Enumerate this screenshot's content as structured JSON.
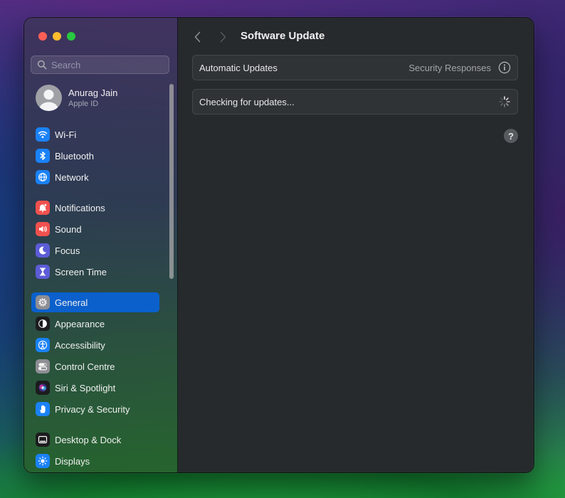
{
  "window": {
    "title": "Software Update"
  },
  "search": {
    "placeholder": "Search"
  },
  "account": {
    "name": "Anurag Jain",
    "subtitle": "Apple ID"
  },
  "sidebar": {
    "items": [
      {
        "label": "Wi-Fi",
        "icon": "wifi-icon",
        "color": "#1a82f7"
      },
      {
        "label": "Bluetooth",
        "icon": "bluetooth-icon",
        "color": "#1a82f7"
      },
      {
        "label": "Network",
        "icon": "globe-icon",
        "color": "#1a82f7"
      },
      {
        "label": "Notifications",
        "icon": "bell-icon",
        "color": "#f0514e"
      },
      {
        "label": "Sound",
        "icon": "speaker-icon",
        "color": "#f0514e"
      },
      {
        "label": "Focus",
        "icon": "moon-icon",
        "color": "#5c5cd6"
      },
      {
        "label": "Screen Time",
        "icon": "hourglass-icon",
        "color": "#5c5cd6"
      },
      {
        "label": "General",
        "icon": "gear-icon",
        "color": "#8e8e93",
        "selected": true
      },
      {
        "label": "Appearance",
        "icon": "appearance-icon",
        "color": "#1c1c1e"
      },
      {
        "label": "Accessibility",
        "icon": "accessibility-icon",
        "color": "#1a82f7"
      },
      {
        "label": "Control Centre",
        "icon": "toggles-icon",
        "color": "#8e8e93"
      },
      {
        "label": "Siri & Spotlight",
        "icon": "siri-icon",
        "color": "#1c1c1e"
      },
      {
        "label": "Privacy & Security",
        "icon": "hand-icon",
        "color": "#1a82f7"
      },
      {
        "label": "Desktop & Dock",
        "icon": "dock-icon",
        "color": "#1c1c1e"
      },
      {
        "label": "Displays",
        "icon": "sun-icon",
        "color": "#1a82f7"
      }
    ]
  },
  "main": {
    "automatic_updates": {
      "label": "Automatic Updates",
      "secondary": "Security Responses"
    },
    "status": {
      "label": "Checking for updates..."
    },
    "help_label": "?"
  }
}
